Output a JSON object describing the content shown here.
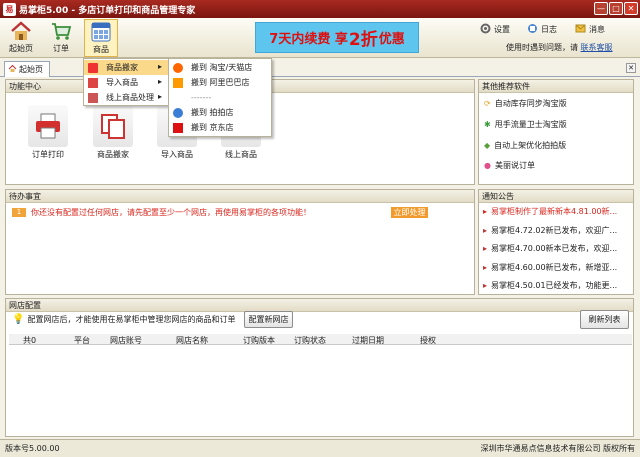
{
  "window": {
    "title": "易掌柜5.00 - 多店订单打印和商品管理专家",
    "app_icon": "易"
  },
  "toolbar": {
    "items": [
      {
        "label": "起始页",
        "icon": "home-icon"
      },
      {
        "label": "订单",
        "icon": "cart-icon"
      },
      {
        "label": "商品",
        "icon": "grid-icon"
      }
    ],
    "active": "商品"
  },
  "banner": {
    "part1": "7天内",
    "part2": "续费 享",
    "big": "2折",
    "part3": "优惠"
  },
  "toplinks": [
    {
      "label": "设置",
      "icon": "gear-icon"
    },
    {
      "label": "日志",
      "icon": "log-icon"
    },
    {
      "label": "消息",
      "icon": "message-icon"
    }
  ],
  "welcome": {
    "text": "使用时遇到问题，请",
    "link": "联系客服"
  },
  "tab": {
    "label": "起始页"
  },
  "function_center": {
    "title": "功能中心",
    "items": [
      {
        "label": "订单打印",
        "icon": "printer-icon"
      },
      {
        "label": "商品搬家",
        "icon": "copy-icon"
      },
      {
        "label": "导入商品",
        "icon": "import-icon"
      },
      {
        "label": "线上商品",
        "icon": "online-icon"
      }
    ]
  },
  "recommend": {
    "title": "其他推荐软件",
    "items": [
      "自动库存同步淘宝版",
      "甩手流量卫士淘宝版",
      "自动上架优化拍拍版",
      "美丽说订单"
    ]
  },
  "todo": {
    "title": "待办事宜",
    "index": "1",
    "text": "你还没有配置过任何网店，请先配置至少一个网店，再使用易掌柜的各项功能！",
    "action": "立即处理"
  },
  "announce": {
    "title": "通知公告",
    "items": [
      "易掌柜制作了最新新本4.81.00新...",
      "易掌柜4.72.02新已发布，欢迎广...",
      "易掌柜4.70.00新本已发布，欢迎...",
      "易掌柜4.60.00新已发布，新增亚...",
      "易掌柜4.50.01已经发布，功能更..."
    ]
  },
  "store_config": {
    "title": "网店配置",
    "hint": "配置网店后，才能使用在易掌柜中管理您网店的商品和订单",
    "configure_button": "配置新网店",
    "refresh_button": "刷新列表",
    "columns": [
      "共0",
      "平台",
      "网店账号",
      "网店名称",
      "订购版本",
      "订购状态",
      "过期日期",
      "授权"
    ]
  },
  "menu": {
    "items": [
      {
        "label": "商品搬家",
        "has_sub": true,
        "highlight": true
      },
      {
        "label": "导入商品",
        "has_sub": true,
        "highlight": false
      },
      {
        "label": "线上商品处理",
        "has_sub": true,
        "highlight": false
      }
    ],
    "submenu": [
      {
        "label": "搬到 淘宝/天猫店",
        "icon": "taobao-icon"
      },
      {
        "label": "搬到 阿里巴巴店",
        "icon": "alibaba-icon"
      },
      {
        "label": "-------",
        "icon": ""
      },
      {
        "label": "搬到 拍拍店",
        "icon": "paipai-icon"
      },
      {
        "label": "搬到 京东店",
        "icon": "jd-icon"
      }
    ]
  },
  "status": {
    "version": "版本号5.00.00",
    "company": "深圳市华通易点信息技术有限公司 版权所有"
  },
  "colors": {
    "titlebar": "#8c1e16",
    "accent": "#e0b44a",
    "menu_highlight": "#fbd98a",
    "link": "#1f4fa8",
    "alert": "#d9251c"
  }
}
